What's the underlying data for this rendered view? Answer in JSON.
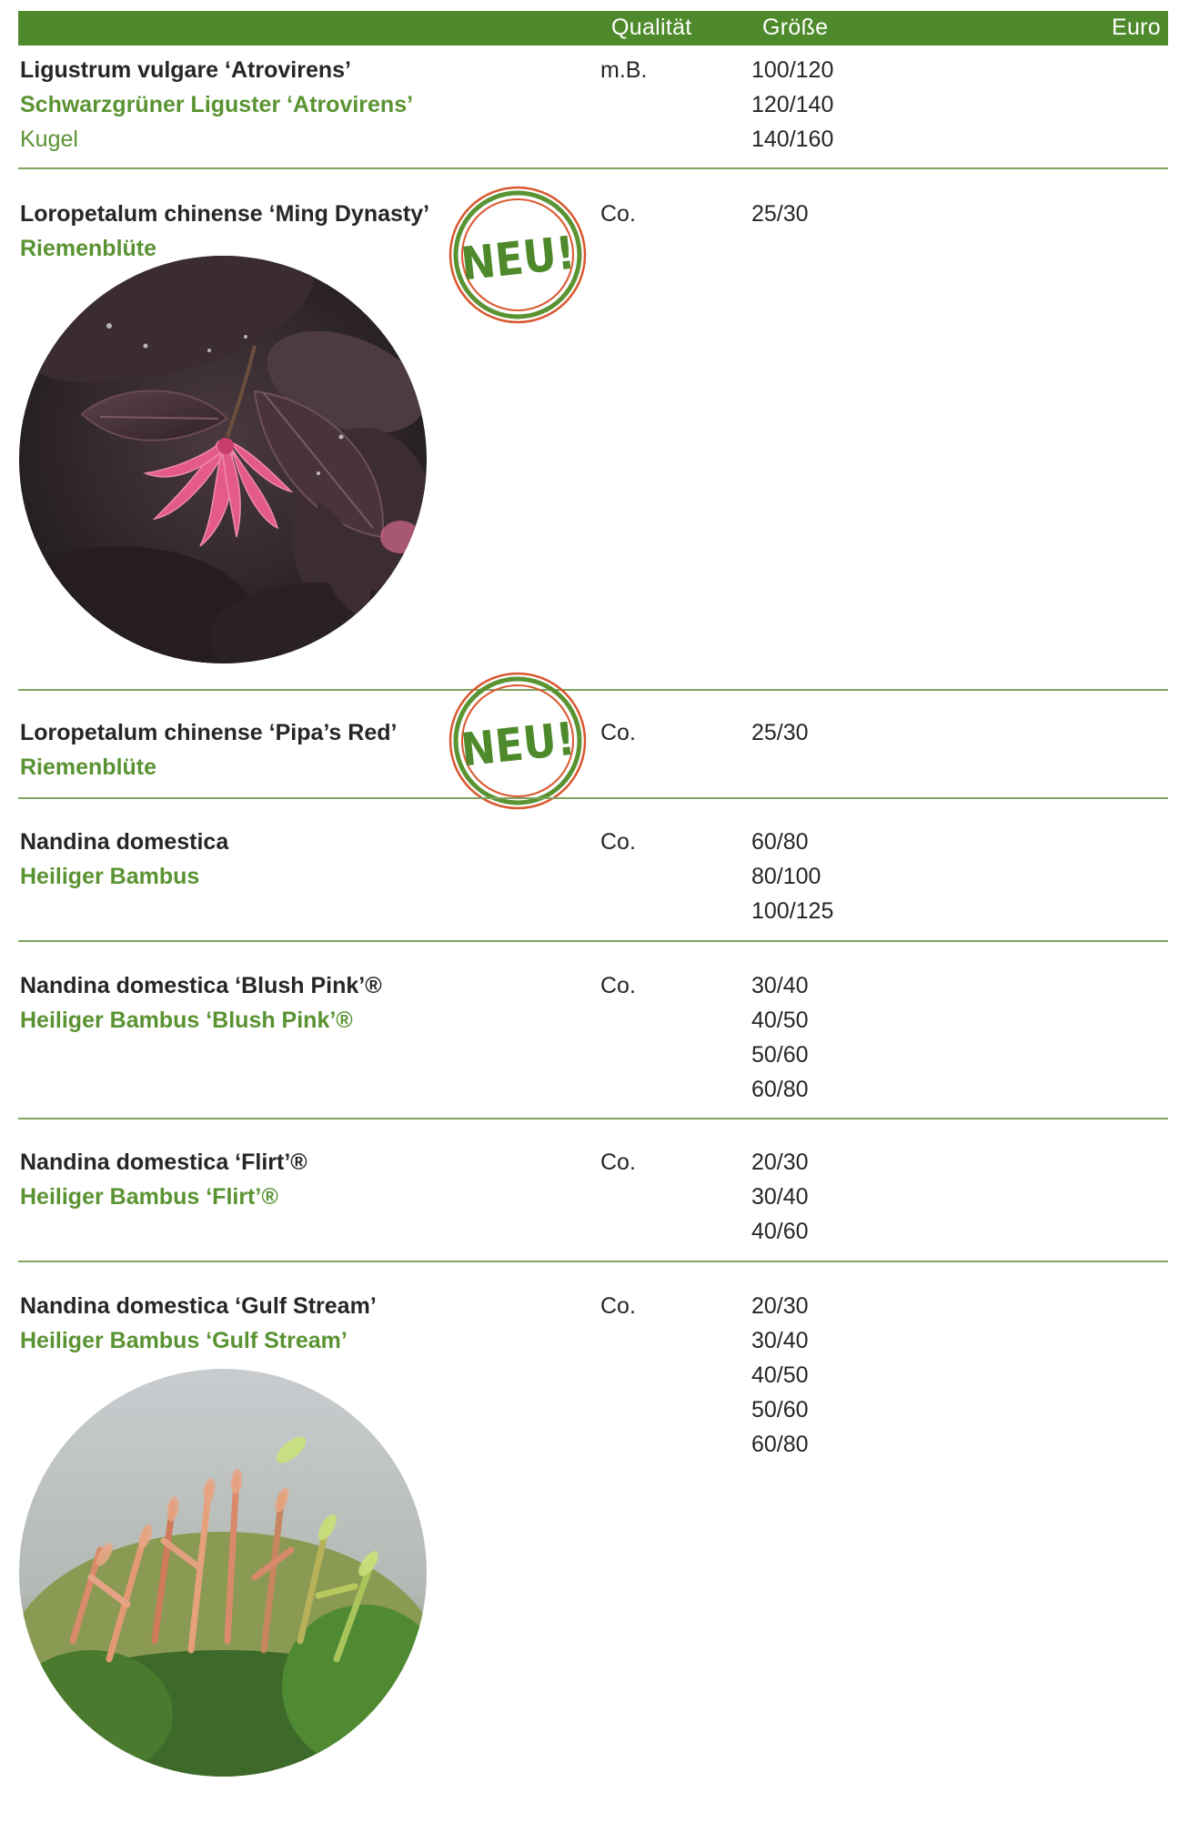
{
  "header": {
    "quality_label": "Qualität",
    "size_label": "Größe",
    "price_label": "Euro"
  },
  "badge_text": "NEU!",
  "colors": {
    "header_green": "#4e8a2b",
    "common_name_green": "#5a9332",
    "divider_green": "#7ea35e",
    "badge_red": "#d9572f"
  },
  "entries": [
    {
      "name": "Ligustrum vulgare ‘Atrovirens’",
      "common": "Schwarzgrüner Liguster ‘Atrovirens’",
      "extra": "Kugel",
      "quality": "m.B.",
      "sizes": [
        "100/120",
        "120/140",
        "140/160"
      ]
    },
    {
      "name": "Loropetalum chinense ‘Ming Dynasty’",
      "common": "Riemenblüte",
      "quality": "Co.",
      "sizes": [
        "25/30"
      ],
      "is_new": true,
      "photo": "loropetalum-flower-photo"
    },
    {
      "name": "Loropetalum chinense ‘Pipa’s Red’",
      "common": "Riemenblüte",
      "quality": "Co.",
      "sizes": [
        "25/30"
      ],
      "is_new": true
    },
    {
      "name": "Nandina domestica",
      "common": "Heiliger Bambus",
      "quality": "Co.",
      "sizes": [
        "60/80",
        "80/100",
        "100/125"
      ]
    },
    {
      "name": "Nandina domestica ‘Blush Pink’®",
      "common": "Heiliger Bambus ‘Blush Pink’®",
      "quality": "Co.",
      "sizes": [
        "30/40",
        "40/50",
        "50/60",
        "60/80"
      ]
    },
    {
      "name": "Nandina domestica ‘Flirt’®",
      "common": "Heiliger Bambus ‘Flirt’®",
      "quality": "Co.",
      "sizes": [
        "20/30",
        "30/40",
        "40/60"
      ]
    },
    {
      "name": "Nandina domestica ‘Gulf Stream’",
      "common": "Heiliger Bambus ‘Gulf Stream’",
      "quality": "Co.",
      "sizes": [
        "20/30",
        "30/40",
        "40/50",
        "50/60",
        "60/80"
      ],
      "photo": "nandina-shrub-photo"
    }
  ]
}
